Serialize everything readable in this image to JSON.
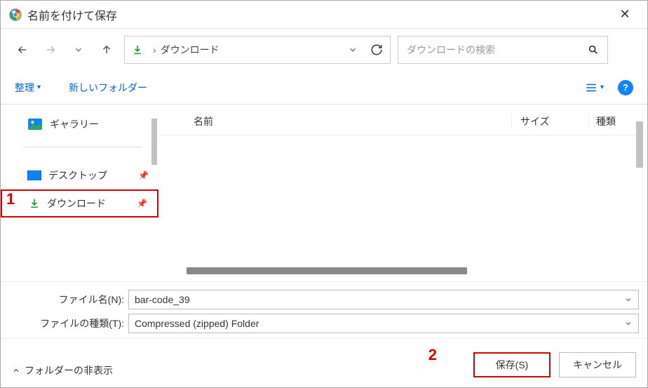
{
  "titlebar": {
    "title": "名前を付けて保存"
  },
  "nav": {
    "path_label": "ダウンロード",
    "search_placeholder": "ダウンロードの検索"
  },
  "toolbar": {
    "organize": "整理",
    "new_folder": "新しいフォルダー"
  },
  "sidebar": {
    "gallery": "ギャラリー",
    "desktop": "デスクトップ",
    "downloads": "ダウンロード"
  },
  "columns": {
    "name": "名前",
    "size": "サイズ",
    "type": "種類"
  },
  "form": {
    "filename_label": "ファイル名(N):",
    "filename_value": "bar-code_39",
    "filetype_label": "ファイルの種類(T):",
    "filetype_value": "Compressed (zipped) Folder"
  },
  "footer": {
    "hide_folders": "フォルダーの非表示",
    "save": "保存(S)",
    "cancel": "キャンセル"
  },
  "annotations": {
    "one": "1",
    "two": "2"
  }
}
